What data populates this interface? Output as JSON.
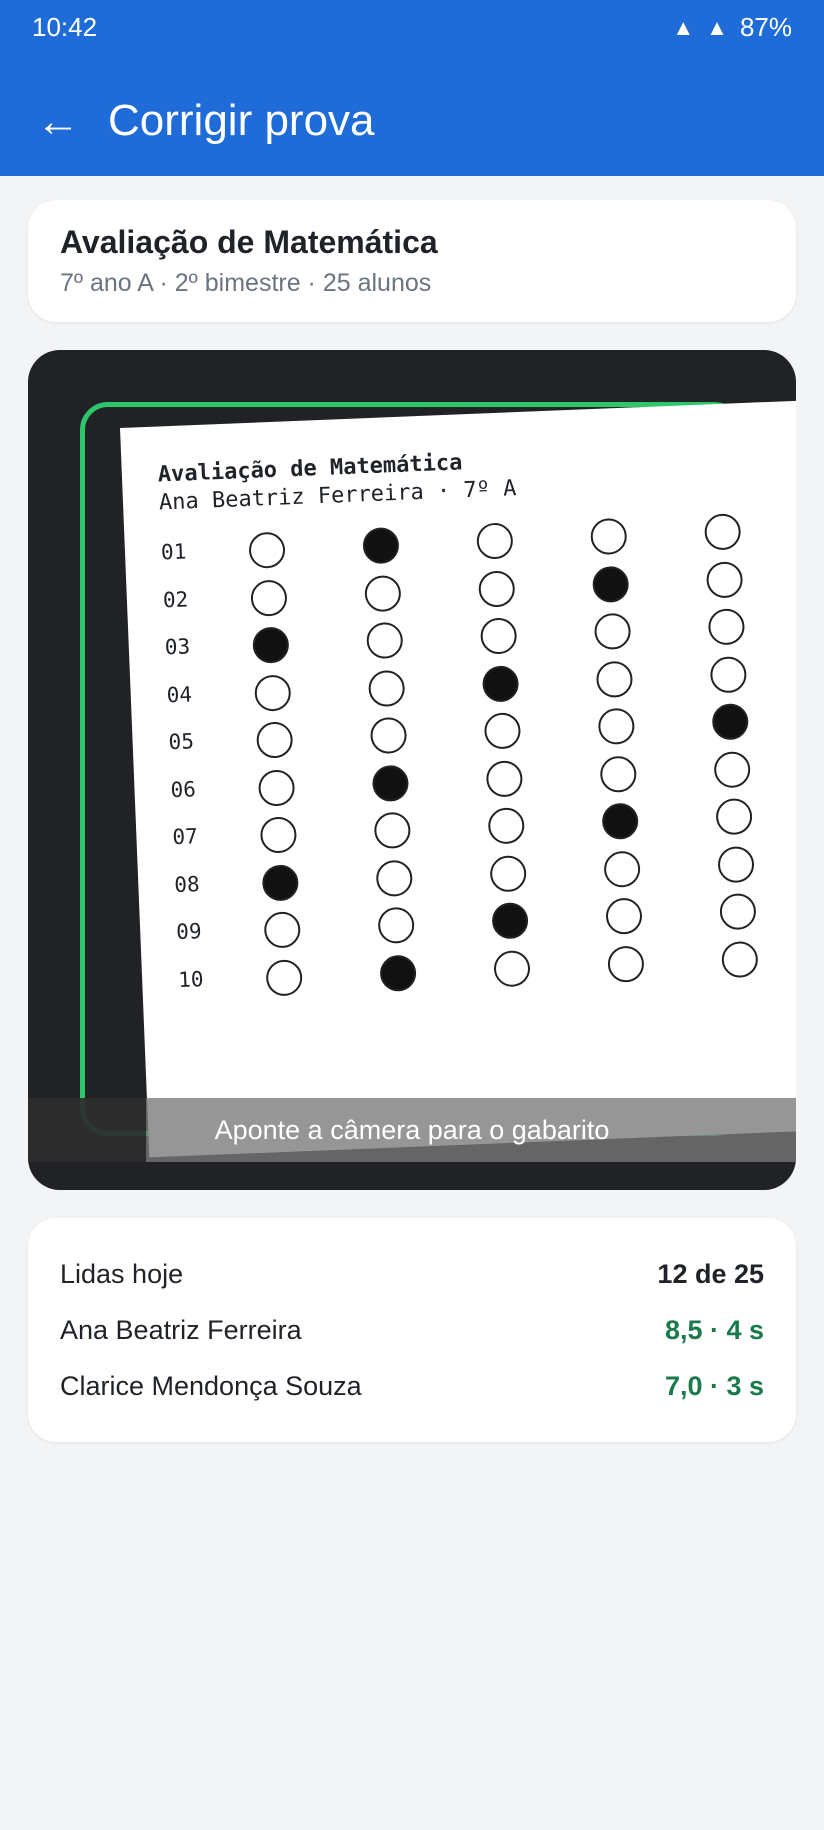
{
  "status_bar": {
    "time": "10:42",
    "signal_icon": "▲",
    "wifi_icon": "▲",
    "battery": "87%"
  },
  "app_bar": {
    "back_icon": "←",
    "title": "Corrigir prova"
  },
  "exam": {
    "title": "Avaliação de Matemática",
    "subtitle": "7º ano A · 2º bimestre · 25 alunos"
  },
  "scan": {
    "sheet_title": "Avaliação de Matemática",
    "sheet_student": "Ana Beatriz Ferreira · 7º A",
    "answers": [
      {
        "q": "01",
        "marked": 2
      },
      {
        "q": "02",
        "marked": 4
      },
      {
        "q": "03",
        "marked": 1
      },
      {
        "q": "04",
        "marked": 3
      },
      {
        "q": "05",
        "marked": 5
      },
      {
        "q": "06",
        "marked": 2
      },
      {
        "q": "07",
        "marked": 4
      },
      {
        "q": "08",
        "marked": 1
      },
      {
        "q": "09",
        "marked": 3
      },
      {
        "q": "10",
        "marked": 2
      }
    ],
    "hint": "Aponte a câmera para o gabarito",
    "frame_color": "#2ec66a"
  },
  "stats": {
    "read_today_label": "Lidas hoje",
    "read_today_value": "12 de 25",
    "results": [
      {
        "name": "Ana Beatriz Ferreira",
        "score": "8,5 · 4 s"
      },
      {
        "name": "Clarice Mendonça Souza",
        "score": "7,0 · 3 s"
      }
    ]
  },
  "colors": {
    "primary": "#1f6cd8",
    "success": "#1a7a4c",
    "background": "#f3f4f6"
  }
}
